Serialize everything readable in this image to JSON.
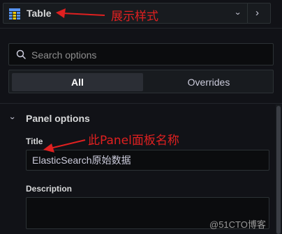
{
  "visualization": {
    "name": "Table",
    "icon": "table-icon"
  },
  "search": {
    "placeholder": "Search options"
  },
  "tabs": [
    {
      "label": "All",
      "active": true
    },
    {
      "label": "Overrides",
      "active": false
    }
  ],
  "section": {
    "title": "Panel options"
  },
  "fields": {
    "title_label": "Title",
    "title_value": "ElasticSearch原始数据",
    "description_label": "Description",
    "description_value": ""
  },
  "annotations": {
    "style_note": "展示样式",
    "panel_name_note": "此Panel面板名称"
  },
  "watermark": "@51CTO博客",
  "colors": {
    "background": "#111217",
    "annotation": "#e02020",
    "icon_blue": "#5794f2"
  }
}
